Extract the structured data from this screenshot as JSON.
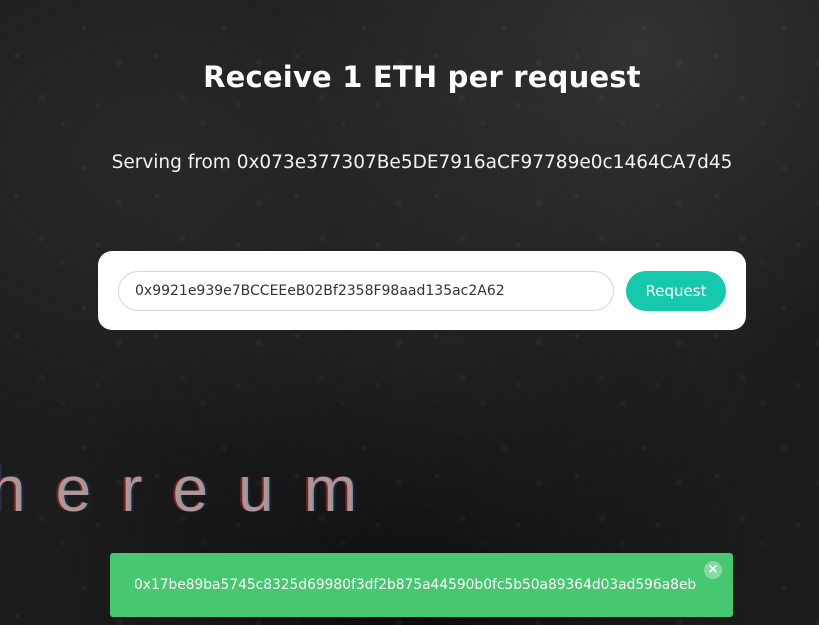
{
  "page": {
    "title": "Receive 1 ETH per request",
    "serving_text": "Serving from 0x073e377307Be5DE7916aCF97789e0c1464CA7d45",
    "background_word": "hereum"
  },
  "form": {
    "address_value": "0x9921e939e7BCCEEeB02Bf2358F98aad135ac2A62",
    "request_label": "Request"
  },
  "toast": {
    "message": "0x17be89ba5745c8325d69980f3df2b875a44590b0fc5b50a89364d03ad596a8eb",
    "close_icon": "close-icon"
  },
  "colors": {
    "accent": "#16c9ac",
    "success": "#47c770",
    "background": "#1c1c1c"
  }
}
